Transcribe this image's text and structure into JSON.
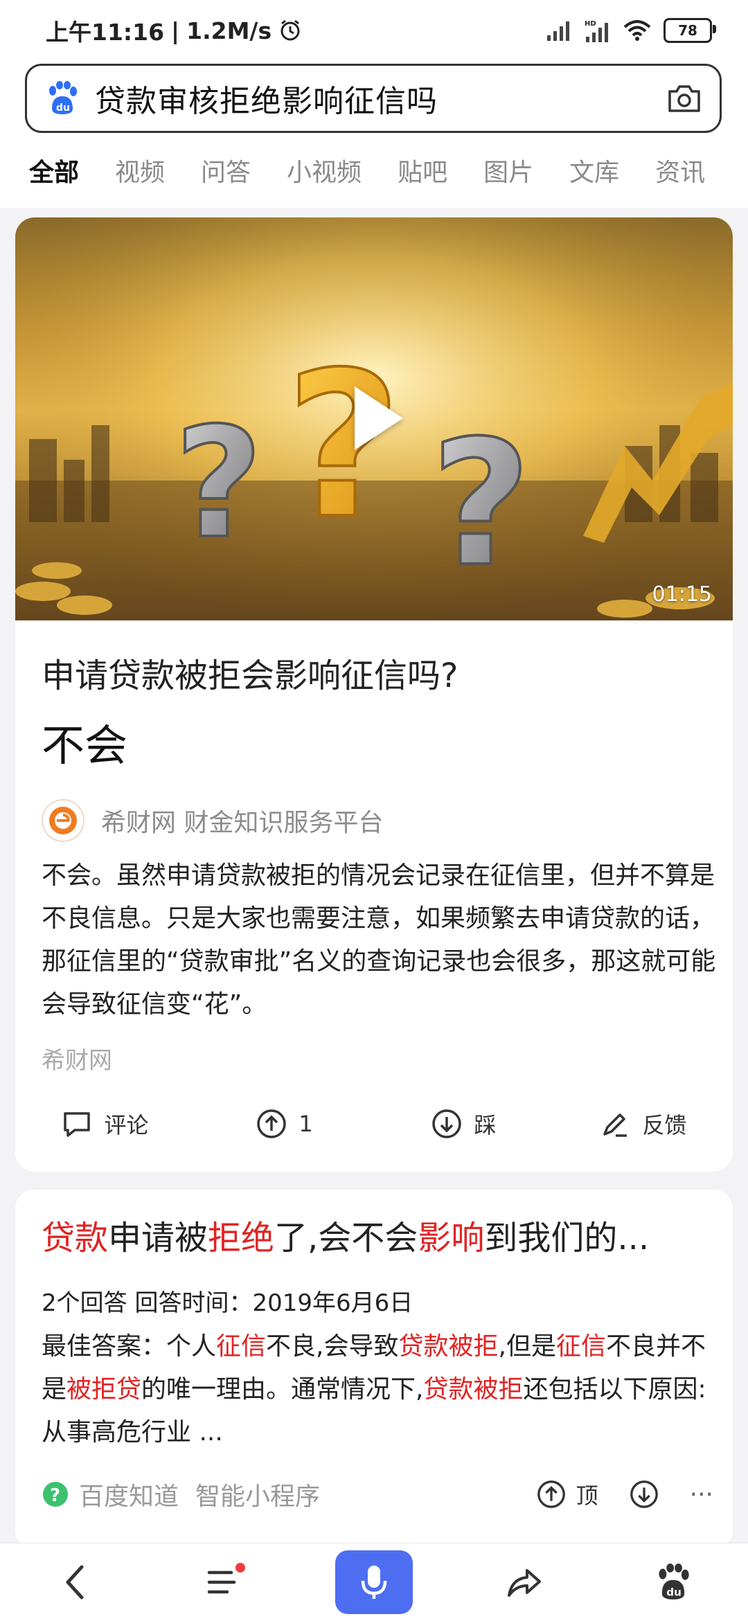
{
  "status_bar": {
    "time": "上午11:16",
    "speed": "1.2M/s",
    "battery": "78"
  },
  "search": {
    "query": "贷款审核拒绝影响征信吗"
  },
  "tabs": [
    {
      "label": "全部"
    },
    {
      "label": "视频"
    },
    {
      "label": "问答"
    },
    {
      "label": "小视频"
    },
    {
      "label": "贴吧"
    },
    {
      "label": "图片"
    },
    {
      "label": "文库"
    },
    {
      "label": "资讯"
    }
  ],
  "card1": {
    "video_duration": "01:15",
    "question": "申请贷款被拒会影响征信吗?",
    "answer_short": "不会",
    "source_name": "希财网 财金知识服务平台",
    "answer_body": "不会。虽然申请贷款被拒的情况会记录在征信里，但并不算是不良信息。只是大家也需要注意，如果频繁去申请贷款的话，那征信里的“贷款审批”名义的查询记录也会很多，那这就可能会导致征信变“花”。",
    "answer_source": "希财网",
    "actions": {
      "comment": "评论",
      "upvote_count": "1",
      "downvote": "踩",
      "feedback": "反馈"
    }
  },
  "card2": {
    "title_parts": [
      "贷款",
      "申请被",
      "拒绝",
      "了,会不会",
      "影响",
      "到我们的..."
    ],
    "meta": "2个回答  回答时间：2019年6月6日",
    "body_parts": [
      "最佳答案：个人",
      "征信",
      "不良,会导致",
      "贷款被拒",
      ",但是",
      "征信",
      "不良并不是",
      "被拒贷",
      "的唯一理由。通常情况下,",
      "贷款被拒",
      "还包括以下原因: 从事高危行业 ..."
    ],
    "source": "百度知道",
    "source_sub": "智能小程序",
    "up_label": "顶",
    "more": "···"
  },
  "colors": {
    "accent": "#4e6ef2",
    "highlight": "#e02323"
  }
}
